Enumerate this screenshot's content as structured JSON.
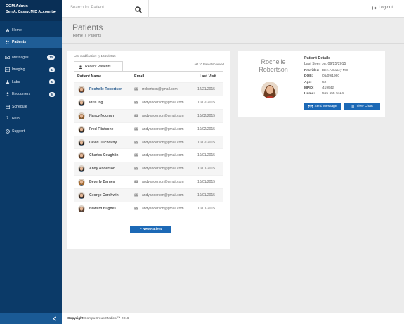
{
  "sidebar": {
    "app_name": "CGM Admin",
    "user_account": "Ben A. Casey, M.D  Account ▸",
    "items": [
      {
        "label": "Home",
        "icon": "home-icon",
        "active": false,
        "badge": ""
      },
      {
        "label": "Patients",
        "icon": "patients-icon",
        "active": true,
        "badge": ""
      },
      {
        "label": "Messages",
        "icon": "envelope-icon",
        "active": false,
        "badge": "10"
      },
      {
        "label": "Imaging",
        "icon": "imaging-icon",
        "active": false,
        "badge": "1"
      },
      {
        "label": "Labs",
        "icon": "flask-icon",
        "active": false,
        "badge": "5"
      },
      {
        "label": "Encounters",
        "icon": "user-icon",
        "active": false,
        "badge": "6"
      },
      {
        "label": "Schedule",
        "icon": "calendar-icon",
        "active": false,
        "badge": ""
      },
      {
        "label": "Help",
        "icon": "question-icon",
        "active": false,
        "badge": ""
      },
      {
        "label": "Support",
        "icon": "support-icon",
        "active": false,
        "badge": ""
      }
    ],
    "collapse_icon": "chevron-left-icon"
  },
  "header": {
    "search_placeholder": "Search for Patient",
    "logout_label": "Log out"
  },
  "page": {
    "title": "Patients",
    "breadcrumb": [
      "Home",
      "/",
      "Patients"
    ]
  },
  "patient_list": {
    "last_modification": "Last modification: ◷ 12/21/2015",
    "tab_label": "Recent Patients",
    "viewed_label": "Last 10 Patients Viewed",
    "columns": [
      "Patient Name",
      "Email",
      "Last Visit"
    ],
    "rows": [
      {
        "name": "Rochelle Robertson",
        "email": "rrobertson@gmail.com",
        "last_visit": "12/21/2015",
        "selected": true
      },
      {
        "name": "Idris Ing",
        "email": "andyanderson@gmail.com",
        "last_visit": "10/02/2015",
        "selected": false
      },
      {
        "name": "Nancy Noonan",
        "email": "andyanderson@gmail.com",
        "last_visit": "10/02/2015",
        "selected": false
      },
      {
        "name": "Fred Flintsone",
        "email": "andyanderson@gmail.com",
        "last_visit": "10/02/2015",
        "selected": false
      },
      {
        "name": "David Duchovny",
        "email": "andyanderson@gmail.com",
        "last_visit": "10/02/2015",
        "selected": false
      },
      {
        "name": "Charles Coughlin",
        "email": "andyanderson@gmail.com",
        "last_visit": "10/01/2015",
        "selected": false
      },
      {
        "name": "Andy Anderson",
        "email": "andyanderson@gmail.com",
        "last_visit": "10/01/2015",
        "selected": false
      },
      {
        "name": "Beverly Barnes",
        "email": "andyanderson@gmail.com",
        "last_visit": "10/01/2015",
        "selected": false
      },
      {
        "name": "George Gershwin",
        "email": "andyanderson@gmail.com",
        "last_visit": "10/01/2015",
        "selected": false
      },
      {
        "name": "Howard Hughes",
        "email": "andyanderson@gmail.com",
        "last_visit": "10/01/2015",
        "selected": false
      }
    ],
    "new_button_label": "+ New Patient"
  },
  "patient_details": {
    "first_name": "Rochelle",
    "last_name": "Robertson",
    "title": "Patient Details",
    "last_seen": "Last Seen on: 09/25/2015",
    "fields": [
      {
        "key": "Provider:",
        "value": "Ben A Casey MD"
      },
      {
        "key": "DOB:",
        "value": "05/09/1960"
      },
      {
        "key": "Age:",
        "value": "52"
      },
      {
        "key": "MPID:",
        "value": "419942"
      },
      {
        "key": "Home:",
        "value": "555-555-5124"
      }
    ],
    "send_label": "Send Message",
    "chart_label": "View Chart"
  },
  "footer": {
    "copyright_bold": "Copyright",
    "copyright_text": "CompuGroup Medical™ 2016"
  },
  "colors": {
    "sidebar": "#0b3a68",
    "sidebar_active": "#1f5d96",
    "accent_button": "#1c69b6",
    "background": "#ececec"
  }
}
